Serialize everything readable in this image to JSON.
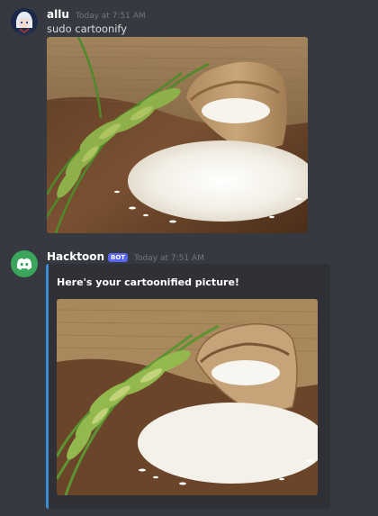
{
  "messages": [
    {
      "author": "allu",
      "timestamp": "Today at 7:51 AM",
      "text": "sudo cartoonify",
      "avatar_icon": "anime-character-avatar",
      "image_alt": "rice-photo"
    },
    {
      "author": "Hacktoon",
      "bot_tag": "BOT",
      "timestamp": "Today at 7:51 AM",
      "avatar_icon": "discord-logo-icon",
      "embed": {
        "title": "Here's your cartoonified picture!",
        "image_alt": "cartoonified-rice-photo"
      }
    }
  ],
  "colors": {
    "background": "#36393f",
    "embed_background": "#2f3136",
    "embed_border": "#3a8fd8",
    "bot_tag": "#5865f2",
    "discord_avatar": "#3ba55c"
  }
}
